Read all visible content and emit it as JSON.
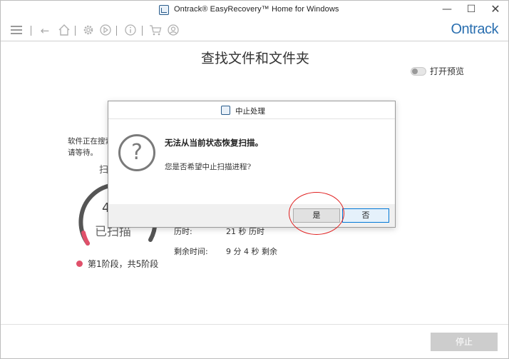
{
  "window": {
    "title": "Ontrack® EasyRecovery™ Home for Windows",
    "controls": {
      "minimize": "—",
      "maximize": "☐",
      "close": "✕"
    }
  },
  "toolbar": {
    "icons": [
      "menu-icon",
      "back-icon",
      "home-icon",
      "settings-icon",
      "play-icon",
      "info-icon",
      "cart-icon",
      "account-icon"
    ],
    "brand": "Ontrack",
    "brand_color": "#2a6fb0"
  },
  "main": {
    "title": "查找文件和文件夹",
    "preview_label": "打开预览",
    "status_text": "软件正在搜索 请等待。",
    "scan_label": "扫",
    "counter": "4",
    "scanned_label": "已扫描",
    "stage_text": "第1阶段，共5阶段",
    "stage_color": "#e0506a",
    "elapsed_label": "历时:",
    "elapsed_value": "21 秒 历时",
    "remaining_label": "剩余时间:",
    "remaining_value": "9 分 4 秒 剩余",
    "stop_button": "停止"
  },
  "dialog": {
    "title": "中止处理",
    "icon": "question-icon",
    "message": "无法从当前状态恢复扫描。",
    "question": "您是否希望中止扫描进程?",
    "yes": "是",
    "no": "否"
  }
}
